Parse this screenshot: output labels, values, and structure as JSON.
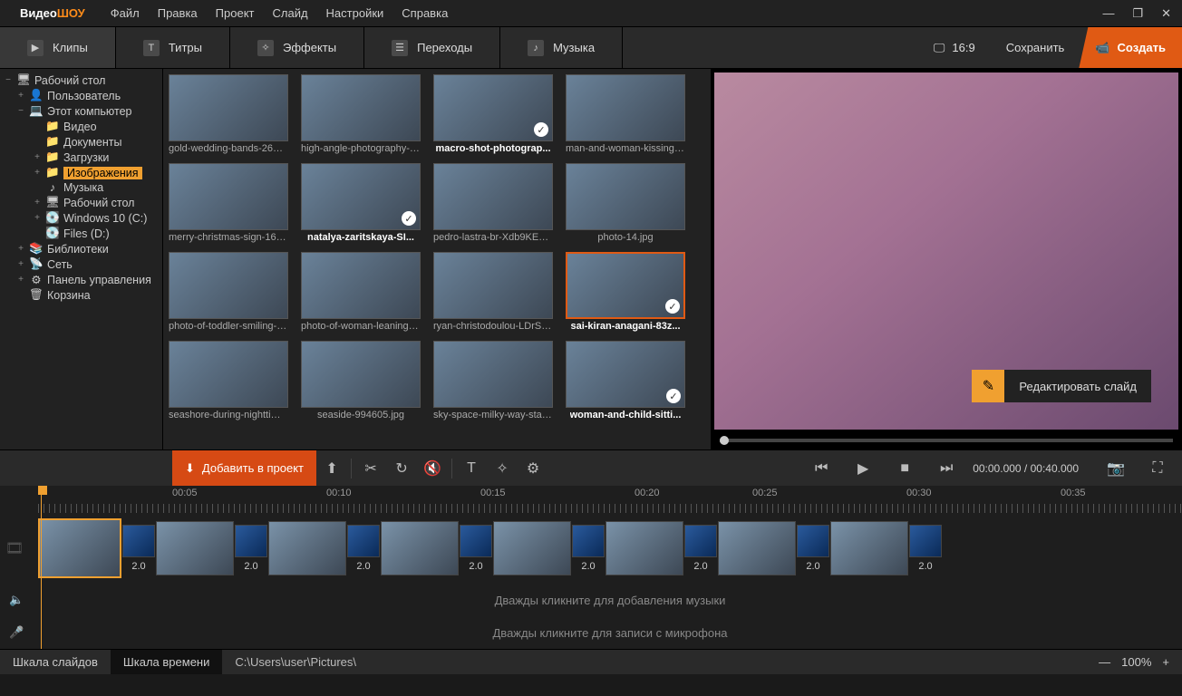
{
  "logo": {
    "a": "Видео",
    "b": "ШОУ"
  },
  "menu": [
    "Файл",
    "Правка",
    "Проект",
    "Слайд",
    "Настройки",
    "Справка"
  ],
  "windowControls": [
    "—",
    "❐",
    "✕"
  ],
  "tabs": [
    {
      "label": "Клипы",
      "icon": "▶"
    },
    {
      "label": "Титры",
      "icon": "T"
    },
    {
      "label": "Эффекты",
      "icon": "✧"
    },
    {
      "label": "Переходы",
      "icon": "☰"
    },
    {
      "label": "Музыка",
      "icon": "♪"
    }
  ],
  "aspect": "16:9",
  "saveBtn": "Сохранить",
  "createBtn": "Создать",
  "tree": [
    {
      "label": "Рабочий стол",
      "depth": 0,
      "exp": "−",
      "ico": "🖥"
    },
    {
      "label": "Пользователь",
      "depth": 1,
      "exp": "+",
      "ico": "👤"
    },
    {
      "label": "Этот компьютер",
      "depth": 1,
      "exp": "−",
      "ico": "💻"
    },
    {
      "label": "Видео",
      "depth": 2,
      "exp": "",
      "ico": "📁"
    },
    {
      "label": "Документы",
      "depth": 2,
      "exp": "",
      "ico": "📁"
    },
    {
      "label": "Загрузки",
      "depth": 2,
      "exp": "+",
      "ico": "📁"
    },
    {
      "label": "Изображения",
      "depth": 2,
      "exp": "+",
      "ico": "📁",
      "selected": true
    },
    {
      "label": "Музыка",
      "depth": 2,
      "exp": "",
      "ico": "♪"
    },
    {
      "label": "Рабочий стол",
      "depth": 2,
      "exp": "+",
      "ico": "🖥"
    },
    {
      "label": "Windows 10 (C:)",
      "depth": 2,
      "exp": "+",
      "ico": "💽"
    },
    {
      "label": "Files (D:)",
      "depth": 2,
      "exp": "",
      "ico": "💽"
    },
    {
      "label": "Библиотеки",
      "depth": 1,
      "exp": "+",
      "ico": "📚"
    },
    {
      "label": "Сеть",
      "depth": 1,
      "exp": "+",
      "ico": "📡"
    },
    {
      "label": "Панель управления",
      "depth": 1,
      "exp": "+",
      "ico": "⚙"
    },
    {
      "label": "Корзина",
      "depth": 1,
      "exp": "",
      "ico": "🗑"
    }
  ],
  "thumbs": [
    {
      "cap": "gold-wedding-bands-2657...",
      "checked": false,
      "bold": false
    },
    {
      "cap": "high-angle-photography-o...",
      "checked": false,
      "bold": false
    },
    {
      "cap": "macro-shot-photograp...",
      "checked": true,
      "bold": true
    },
    {
      "cap": "man-and-woman-kissing-2...",
      "checked": false,
      "bold": false
    },
    {
      "cap": "merry-christmas-sign-1656...",
      "checked": false,
      "bold": false
    },
    {
      "cap": "natalya-zaritskaya-SI...",
      "checked": true,
      "bold": true
    },
    {
      "cap": "pedro-lastra-br-Xdb9KE0Q...",
      "checked": false,
      "bold": false
    },
    {
      "cap": "photo-14.jpg",
      "checked": false,
      "bold": false
    },
    {
      "cap": "photo-of-toddler-smiling-1...",
      "checked": false,
      "bold": false
    },
    {
      "cap": "photo-of-woman-leaning-o...",
      "checked": false,
      "bold": false
    },
    {
      "cap": "ryan-christodoulou-LDrSJ3...",
      "checked": false,
      "bold": false
    },
    {
      "cap": "sai-kiran-anagani-83z...",
      "checked": true,
      "bold": true,
      "selected": true
    },
    {
      "cap": "seashore-during-nighttime...",
      "checked": false,
      "bold": false
    },
    {
      "cap": "seaside-994605.jpg",
      "checked": false,
      "bold": false
    },
    {
      "cap": "sky-space-milky-way-stars...",
      "checked": false,
      "bold": false
    },
    {
      "cap": "woman-and-child-sitti...",
      "checked": true,
      "bold": true
    }
  ],
  "editSlide": "Редактировать слайд",
  "addProject": "Добавить в проект",
  "playCurrent": "00:00.000",
  "playTotal": "00:40.000",
  "rulerTicks": [
    "00:05",
    "00:10",
    "00:15",
    "00:20",
    "00:25",
    "00:30",
    "00:35"
  ],
  "rulerTickPositions": [
    190,
    360,
    530,
    700,
    830,
    1000,
    1170
  ],
  "transitionDur": "2.0",
  "clipCount": 8,
  "musicHint": "Дважды кликните для добавления музыки",
  "micHint": "Дважды кликните для записи с микрофона",
  "status": {
    "slides": "Шкала слайдов",
    "time": "Шкала времени",
    "path": "C:\\Users\\user\\Pictures\\",
    "zoom": "100%"
  }
}
